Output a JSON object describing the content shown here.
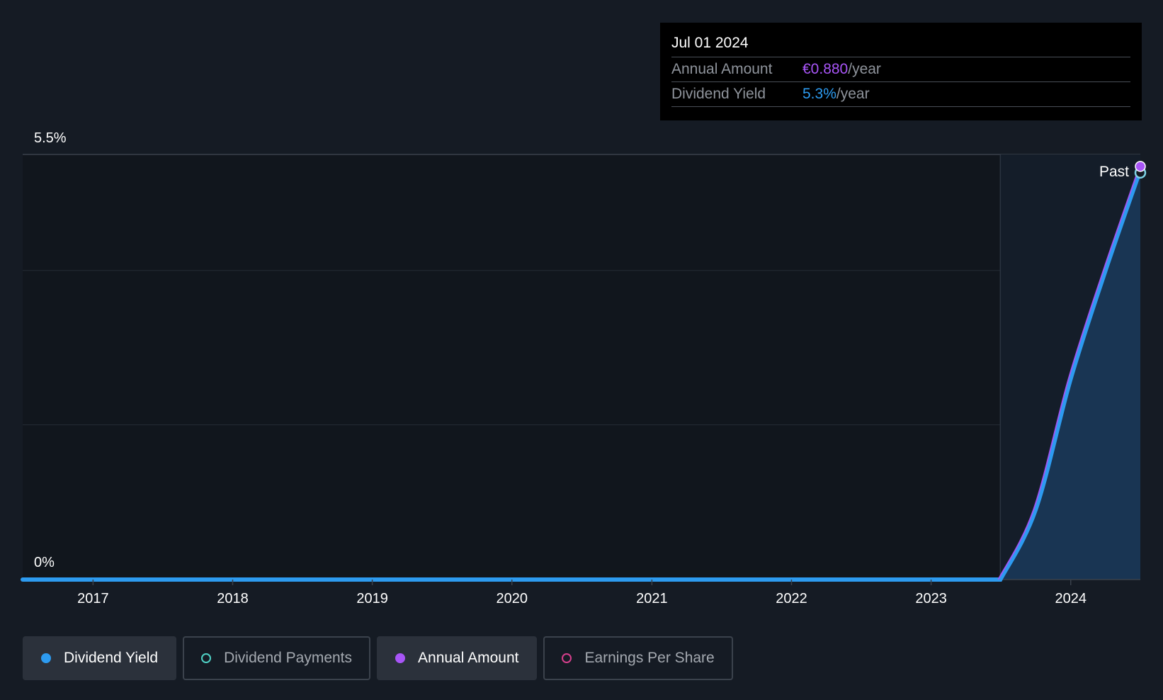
{
  "tooltip": {
    "date": "Jul 01 2024",
    "rows": [
      {
        "label": "Annual Amount",
        "value": "€0.880",
        "unit": "/year",
        "color": "#a855f7"
      },
      {
        "label": "Dividend Yield",
        "value": "5.3%",
        "unit": "/year",
        "color": "#2d9bf0"
      }
    ]
  },
  "chart_data": {
    "type": "line",
    "y_tick_labels": [
      "5.5%",
      "0%"
    ],
    "ylim": [
      0,
      5.5
    ],
    "x_tick_labels": [
      "2017",
      "2018",
      "2019",
      "2020",
      "2021",
      "2022",
      "2023",
      "2024"
    ],
    "xlim": [
      "2016-07-01",
      "2024-07-01"
    ],
    "past_label": "Past",
    "past_region_start": "2023-07-01",
    "grid": true,
    "series": [
      {
        "name": "Dividend Yield",
        "color": "#2d9bf0",
        "points": [
          {
            "x": "2016-07-01",
            "y": 0
          },
          {
            "x": "2023-07-01",
            "y": 0
          },
          {
            "x": "2023-10-01",
            "y": 0.9
          },
          {
            "x": "2024-01-01",
            "y": 2.6
          },
          {
            "x": "2024-04-01",
            "y": 4.0
          },
          {
            "x": "2024-07-01",
            "y": 5.3
          }
        ]
      },
      {
        "name": "Annual Amount",
        "color": "#a855f7",
        "points": [
          {
            "x": "2024-07-01",
            "y": 5.3
          }
        ]
      }
    ]
  },
  "legend": [
    {
      "label": "Dividend Yield",
      "color": "#2d9bf0",
      "active": true
    },
    {
      "label": "Dividend Payments",
      "color": "#4fd1c5",
      "active": false
    },
    {
      "label": "Annual Amount",
      "color": "#a855f7",
      "active": true
    },
    {
      "label": "Earnings Per Share",
      "color": "#d53f8c",
      "active": false
    }
  ]
}
